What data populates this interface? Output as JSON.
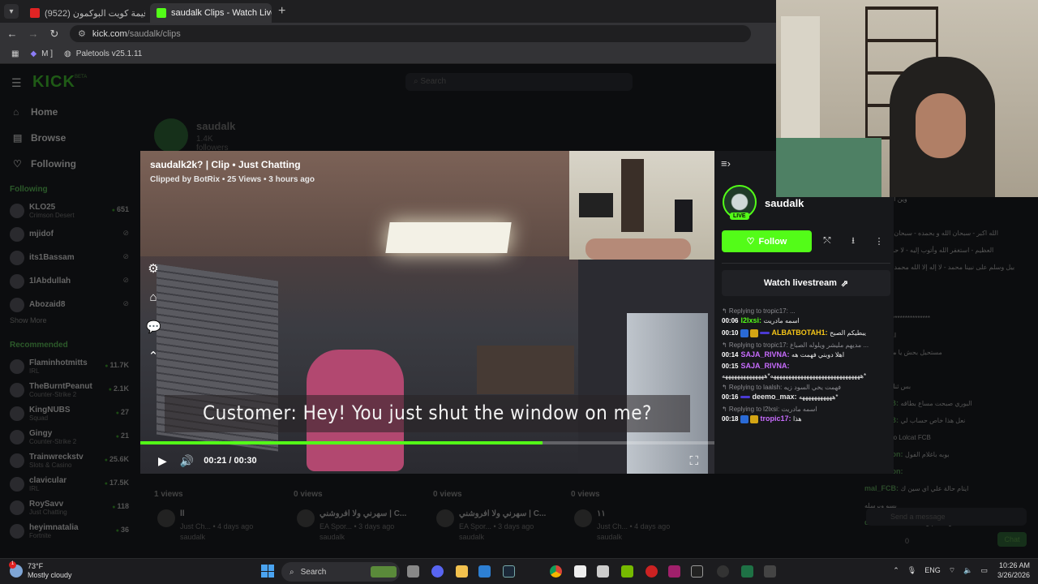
{
  "browser": {
    "tabs": [
      {
        "label": "(9522) كم قيمة كويت البوكمون | ...",
        "active": false
      },
      {
        "label": "saudalk Clips - Watch Live on K",
        "active": true
      }
    ],
    "url_host": "kick.com",
    "url_path": "/saudalk/clips",
    "bookmarks": [
      {
        "label": "M ]"
      },
      {
        "label": "Paletools v25.1.11"
      }
    ]
  },
  "kick": {
    "logo": "KICK",
    "beta": "BETA",
    "search_placeholder": "Search",
    "nav": [
      {
        "label": "Home",
        "icon": "home-icon"
      },
      {
        "label": "Browse",
        "icon": "browse-icon"
      },
      {
        "label": "Following",
        "icon": "heart-icon"
      }
    ],
    "following_title": "Following",
    "following": [
      {
        "name": "KLO25",
        "sub": "Crimson Desert",
        "viewers": "651"
      },
      {
        "name": "mjidof",
        "sub": "",
        "viewers": ""
      },
      {
        "name": "its1Bassam",
        "sub": "",
        "viewers": ""
      },
      {
        "name": "1lAbdullah",
        "sub": "",
        "viewers": ""
      },
      {
        "name": "Abozaid8",
        "sub": "",
        "viewers": ""
      }
    ],
    "show_more": "Show More",
    "recommended_title": "Recommended",
    "recommended": [
      {
        "name": "Flaminhotmitts",
        "sub": "IRL",
        "viewers": "11.7K"
      },
      {
        "name": "TheBurntPeanut",
        "sub": "Counter-Strike 2",
        "viewers": "2.1K"
      },
      {
        "name": "KingNUBS",
        "sub": "Squad",
        "viewers": "27"
      },
      {
        "name": "Gingy",
        "sub": "Counter-Strike 2",
        "viewers": "21"
      },
      {
        "name": "Trainwreckstv",
        "sub": "Slots & Casino",
        "viewers": "25.6K"
      },
      {
        "name": "clavicular",
        "sub": "IRL",
        "viewers": "17.5K"
      },
      {
        "name": "RoySavv",
        "sub": "Just Chatting",
        "viewers": "118"
      },
      {
        "name": "heyimnatalia",
        "sub": "Fortnite",
        "viewers": "36"
      }
    ],
    "channel_name": "saudalk",
    "channel_followers": "1.4K followers",
    "clips": [
      {
        "views": "1 views",
        "title": "ll",
        "meta": "Just Ch... • 4 days ago",
        "author": "saudalk"
      },
      {
        "views": "0 views",
        "title": "سهرني ولا افروشني | C...",
        "meta": "EA Spor... • 3 days ago",
        "author": "saudalk"
      },
      {
        "views": "0 views",
        "title": "سهرني ولا افروشني | C...",
        "meta": "EA Spor... • 3 days ago",
        "author": "saudalk"
      },
      {
        "views": "0 views",
        "title": "١١",
        "meta": "Just Ch... • 4 days ago",
        "author": "saudalk"
      }
    ],
    "chat_bg_lines": [
      {
        "user": "",
        "text": "وين اعطيك يله؟"
      },
      {
        "user": "_max:",
        "text": ""
      },
      {
        "user": "tRix:",
        "text": "الله اكبر - سبحان الله و بحمده - سبحان الله"
      },
      {
        "user": "",
        "text": "العظيم - استغفر الله وأتوب إليه - لا حول و لا قوة"
      },
      {
        "user": "",
        "text": "بيل وسلم على نبينا محمد - لا إله إلا الله محمد رسول الله"
      },
      {
        "user": "",
        "text": "الحمد لله"
      },
      {
        "user": "Rikopa:",
        "text": ""
      },
      {
        "user": "",
        "text": "**************************"
      },
      {
        "user": "",
        "text": "اوبتز مطق؟"
      },
      {
        "user": "",
        "text": "مستحيل بحش يا مودز سووها"
      },
      {
        "user": "Rikopa:",
        "text": ""
      },
      {
        "user": "",
        "text": "بس ثنك انه احمل"
      },
      {
        "user": "mal_FCB:",
        "text": "البوري صبحت مساع بطاقه"
      },
      {
        "user": "mal_FCB:",
        "text": "نعل هذا خاص حساب لي"
      },
      {
        "user": "",
        "text": "Replying to Lolcat FCB"
      },
      {
        "user": "reemawon:",
        "text": "بوبه باغلام الفول"
      },
      {
        "user": "reemawon:",
        "text": ""
      },
      {
        "user": "mal_FCB:",
        "text": "ايتام حالة علي اي سين ك"
      },
      {
        "user": "",
        "text": "بسو ويرسله"
      },
      {
        "user": "deemo_max:",
        "text": "ولا اختم وعطت"
      }
    ],
    "send_placeholder": "Send a message",
    "chat_count": "0",
    "chat_button": "Chat"
  },
  "clip": {
    "title": "saudalk2k? | Clip • Just Chatting",
    "meta": "Clipped by BotRix • 25 Views • 3 hours ago",
    "subtitle": "Customer: Hey! You just shut the window on me?",
    "time": "00:21 / 00:30",
    "progress": 0.7,
    "side_icons": [
      "settings-icon",
      "store-icon",
      "chat-icon",
      "chevrons-up-icon"
    ]
  },
  "panel": {
    "channel": "saudalk",
    "live_badge": "LIVE",
    "follow_label": "Follow",
    "watch_label": "Watch livestream",
    "replay": [
      {
        "type": "reply",
        "text": "Replying to tropic17: ..."
      },
      {
        "time": "00:06",
        "user": "l2lxsi:",
        "color": "#53fc18",
        "badges": [],
        "text": "اسمه مادريت"
      },
      {
        "time": "00:10",
        "user": "ALBATBOTAH1:",
        "color": "#f5c518",
        "badges": [
          "b1",
          "b2",
          "b3"
        ],
        "text": "يبطيكم الصبح"
      },
      {
        "type": "reply",
        "text": "Replying to tropic17: مديهم مليشر ويلوله الصباغ ..."
      },
      {
        "time": "00:14",
        "user": "SAJA_RIVNA:",
        "color": "#c86cff",
        "badges": [],
        "text": "اهلا دوبني فهمت هه"
      },
      {
        "time": "00:15",
        "user": "SAJA_RIVNA:",
        "color": "#c86cff",
        "badges": [],
        "text": "ههههههههههههههههههههههههههههههه*ههههههههههههههه*"
      },
      {
        "type": "reply",
        "text": "Replying to laalsh: فهمت يخي السود زيه"
      },
      {
        "time": "00:16",
        "user": "deemo_max:",
        "color": "#e6e6e6",
        "badges": [
          "b3"
        ],
        "text": "هههههههههههه*"
      },
      {
        "type": "reply",
        "text": "Replying to l2lxsi: اسمه مادريت"
      },
      {
        "time": "00:18",
        "user": "tropic17:",
        "color": "#c86cff",
        "badges": [
          "b1",
          "b2"
        ],
        "text": "هذا"
      }
    ]
  },
  "taskbar": {
    "temp": "73°F",
    "weather": "Mostly cloudy",
    "notif": "1",
    "search": "Search",
    "lang": "ENG",
    "time": "10:26 AM",
    "date": "3/26/2026"
  },
  "colors": {
    "kick_green": "#53fc18",
    "panel_bg": "#17181b",
    "page_bg": "#0c0d0f"
  }
}
